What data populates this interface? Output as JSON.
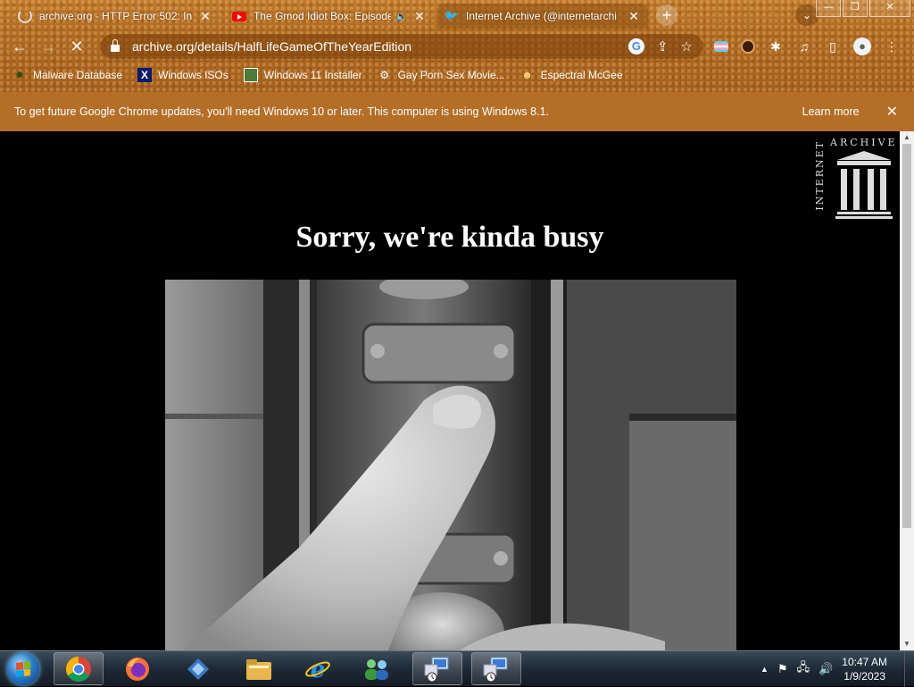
{
  "tabs": [
    {
      "title": "archive.org - HTTP Error 502: In",
      "icon": "loading-spinner-icon",
      "active": false
    },
    {
      "title": "The Gmod Idiot Box: Episode",
      "icon": "youtube-icon",
      "audio": true,
      "active": false
    },
    {
      "title": "Internet Archive (@internetarchi",
      "icon": "twitter-icon",
      "active": true
    }
  ],
  "toolbar": {
    "url": "archive.org/details/HalfLifeGameOfTheYearEdition"
  },
  "bookmarks": [
    {
      "label": "Malware Database",
      "icon": "virus-icon"
    },
    {
      "label": "Windows ISOs",
      "icon": "x-icon"
    },
    {
      "label": "Windows 11 Installer",
      "icon": "image-icon"
    },
    {
      "label": "Gay Porn Sex Movie...",
      "icon": "gear-icon"
    },
    {
      "label": "Espectral McGee",
      "icon": "face-icon"
    }
  ],
  "infobar": {
    "message": "To get future Google Chrome updates, you'll need Windows 10 or later. This computer is using Windows 8.1.",
    "learn_more": "Learn more"
  },
  "page": {
    "logo_vertical": "INTERNET",
    "logo_horizontal": "ARCHIVE",
    "heading": "Sorry, we're kinda busy"
  },
  "taskbar": {
    "time": "10:47 AM",
    "date": "1/9/2023",
    "apps": [
      "chrome",
      "firefox",
      "vscode",
      "file-explorer",
      "internet-explorer",
      "people",
      "network-1",
      "network-2"
    ]
  },
  "colors": {
    "infobar": "#b46e27",
    "page_background": "#000000",
    "heading": "#ffffff"
  }
}
